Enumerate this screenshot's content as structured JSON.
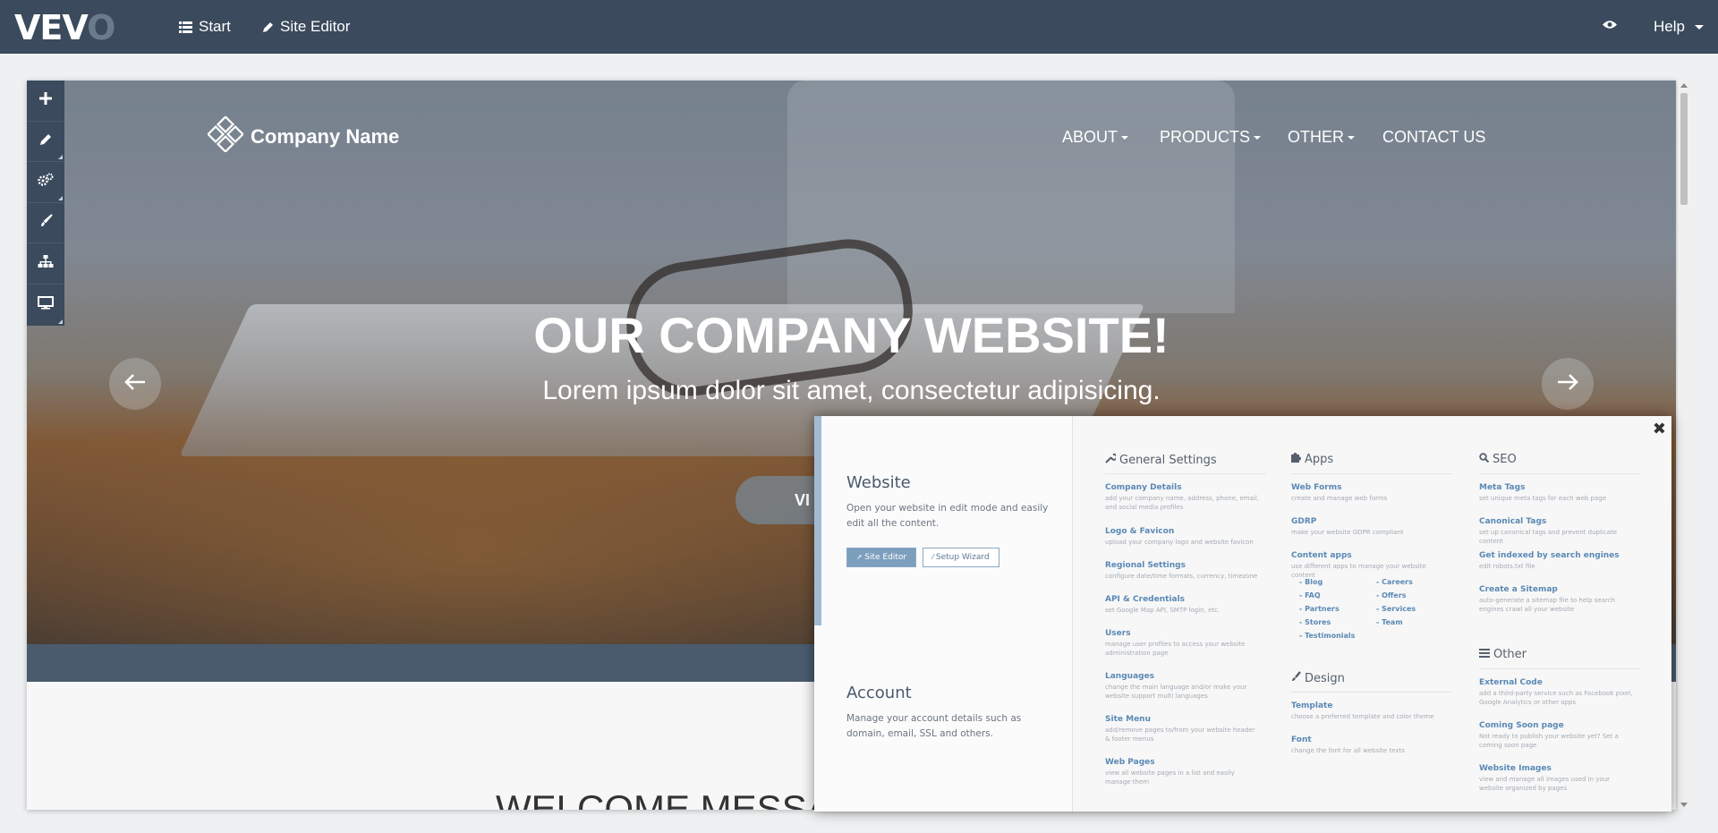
{
  "topbar": {
    "logo": "VEVO",
    "nav": [
      {
        "label": "Start",
        "icon": "list-icon"
      },
      {
        "label": "Site Editor",
        "icon": "pencil-icon"
      }
    ],
    "help": "Help"
  },
  "toolbar": {
    "tools": [
      "plus-icon",
      "pencil-icon",
      "gears-icon",
      "brush-icon",
      "sitemap-icon",
      "desktop-icon"
    ]
  },
  "site": {
    "brand": "Company Name",
    "nav": [
      "ABOUT",
      "PRODUCTS",
      "OTHER",
      "CONTACT US"
    ],
    "hero_title": "OUR COMPANY WEBSITE!",
    "hero_sub": "Lorem ipsum dolor sit amet,  consectetur adipisicing.",
    "hero_button": "VI",
    "welcome": "WELCOME MESSA"
  },
  "panel": {
    "website": {
      "title": "Website",
      "desc": "Open your website in edit mode and easily edit all the content.",
      "btn_primary": "Site Editor",
      "btn_secondary": "Setup Wizard"
    },
    "account": {
      "title": "Account",
      "desc": "Manage your account details such as domain, email, SSL and others."
    },
    "general": {
      "heading": "General Settings",
      "items": [
        {
          "title": "Company Details",
          "desc": "add your company name, address, phone, email, and social media profiles"
        },
        {
          "title": "Logo & Favicon",
          "desc": "upload your company logo and website favicon"
        },
        {
          "title": "Regional Settings",
          "desc": "configure date/time formats, currency, timezone"
        },
        {
          "title": "API & Credentials",
          "desc": "set Google Map API, SMTP login, etc."
        },
        {
          "title": "Users",
          "desc": "manage user profiles to access your website administration page"
        },
        {
          "title": "Languages",
          "desc": "change the main language and/or make your website support multi languages"
        },
        {
          "title": "Site Menu",
          "desc": "add/remove pages to/from your website header & footer menus"
        },
        {
          "title": "Web Pages",
          "desc": "view all website pages in a list and easily manage them"
        }
      ]
    },
    "apps": {
      "heading": "Apps",
      "items": [
        {
          "title": "Web Forms",
          "desc": "create and manage web forms"
        },
        {
          "title": "GDRP",
          "desc": "make your website GDPR compliant"
        },
        {
          "title": "Content apps",
          "desc": "use different apps to manage your website content"
        }
      ],
      "content_apps_left": [
        "- Blog",
        "- FAQ",
        "- Partners",
        "- Stores",
        "- Testimonials"
      ],
      "content_apps_right": [
        "- Careers",
        "- Offers",
        "- Services",
        "- Team"
      ]
    },
    "design": {
      "heading": "Design",
      "items": [
        {
          "title": "Template",
          "desc": "choose a preferred template and color theme"
        },
        {
          "title": "Font",
          "desc": "change the font for all website texts"
        }
      ]
    },
    "seo": {
      "heading": "SEO",
      "items": [
        {
          "title": "Meta Tags",
          "desc": "set unique meta tags for each web page"
        },
        {
          "title": "Canonical Tags",
          "desc": "set up canonical tags and prevent duplicate content"
        },
        {
          "title": "Get indexed by search engines",
          "desc": "edit robots.txt file"
        },
        {
          "title": "Create a Sitemap",
          "desc": "auto-generate a sitemap file to help search engines crawl all your website"
        }
      ]
    },
    "other": {
      "heading": "Other",
      "items": [
        {
          "title": "External Code",
          "desc": "add a third-party service such as Facebook pixel, Google Analytics or other apps"
        },
        {
          "title": "Coming Soon page",
          "desc": "Not ready to publish your website yet? Set a coming soon page"
        },
        {
          "title": "Website Images",
          "desc": "view and manage all images used in your website organized by pages"
        }
      ]
    }
  }
}
